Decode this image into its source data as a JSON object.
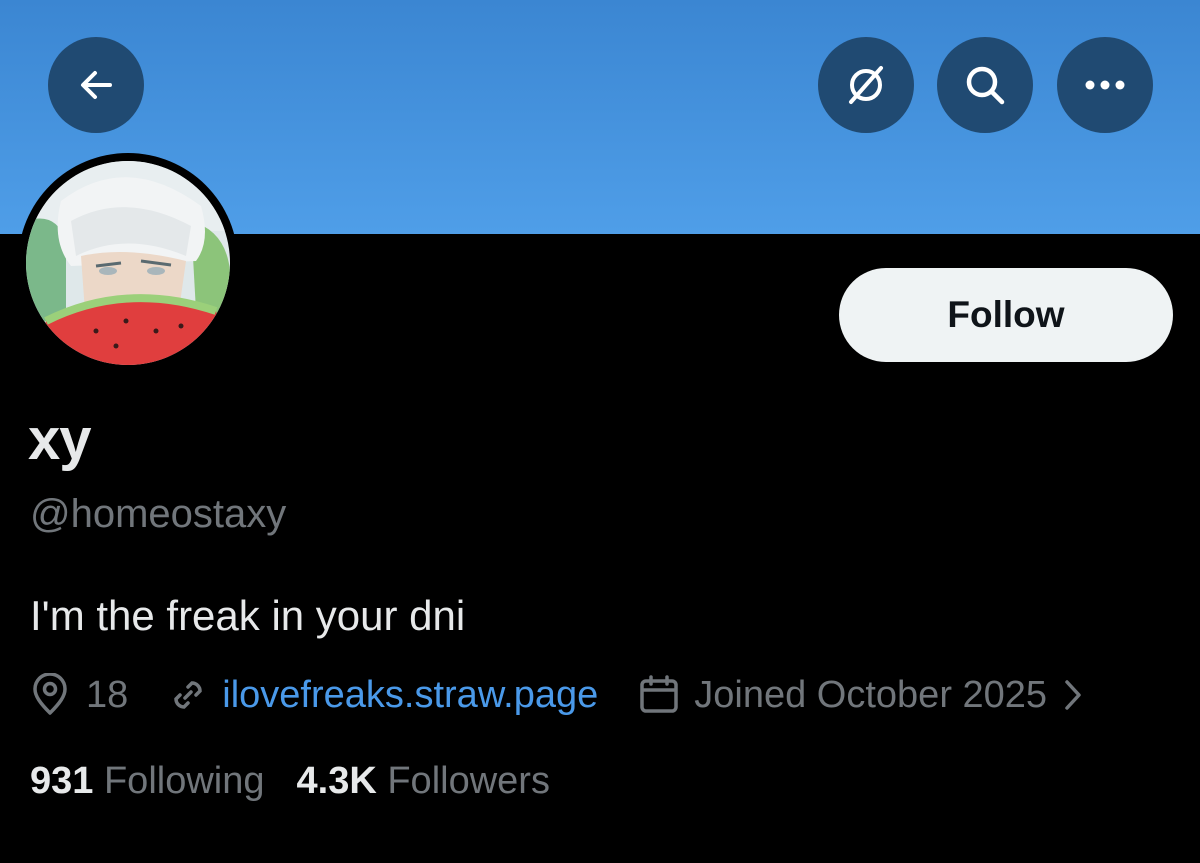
{
  "header": {
    "back_icon": "arrow-left-icon",
    "grok_icon": "grok-icon",
    "search_icon": "search-icon",
    "more_icon": "more-horizontal-icon",
    "banner_color": "#4a9be6",
    "button_color": "#204a72"
  },
  "profile": {
    "display_name": "xy",
    "handle": "@homeostaxy",
    "bio": "I'm the freak in your dni",
    "location": "18",
    "website": "ilovefreaks.straw.page",
    "joined": "Joined October 2025",
    "follow_label": "Follow"
  },
  "stats": {
    "following_count": "931",
    "following_label": "Following",
    "followers_count": "4.3K",
    "followers_label": "Followers"
  },
  "colors": {
    "link": "#4a99e9",
    "muted": "#71767b",
    "text": "#e7e9ea"
  }
}
